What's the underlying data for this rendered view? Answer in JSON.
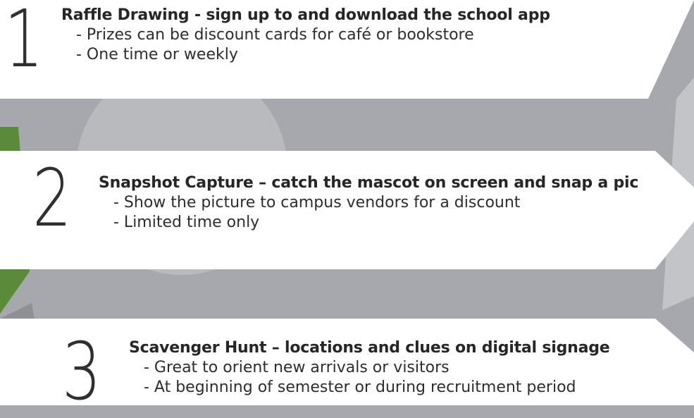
{
  "colors": {
    "background": "#a6a8ad",
    "panel": "#ffffff",
    "accent_green": "#5a8a3a",
    "text": "#262626"
  },
  "items": [
    {
      "number": "1",
      "title": "Raffle Drawing - sign up to and download the school app",
      "bullets": [
        "- Prizes can be discount cards for café or bookstore",
        "- One time or weekly"
      ]
    },
    {
      "number": "2",
      "title": "Snapshot Capture – catch the mascot on screen and snap a pic",
      "bullets": [
        "- Show the picture to campus vendors for a discount",
        "- Limited time only"
      ]
    },
    {
      "number": "3",
      "title": "Scavenger Hunt – locations and clues on digital signage",
      "bullets": [
        "- Great to orient new arrivals or visitors",
        "- At beginning of semester or during recruitment period"
      ]
    }
  ]
}
